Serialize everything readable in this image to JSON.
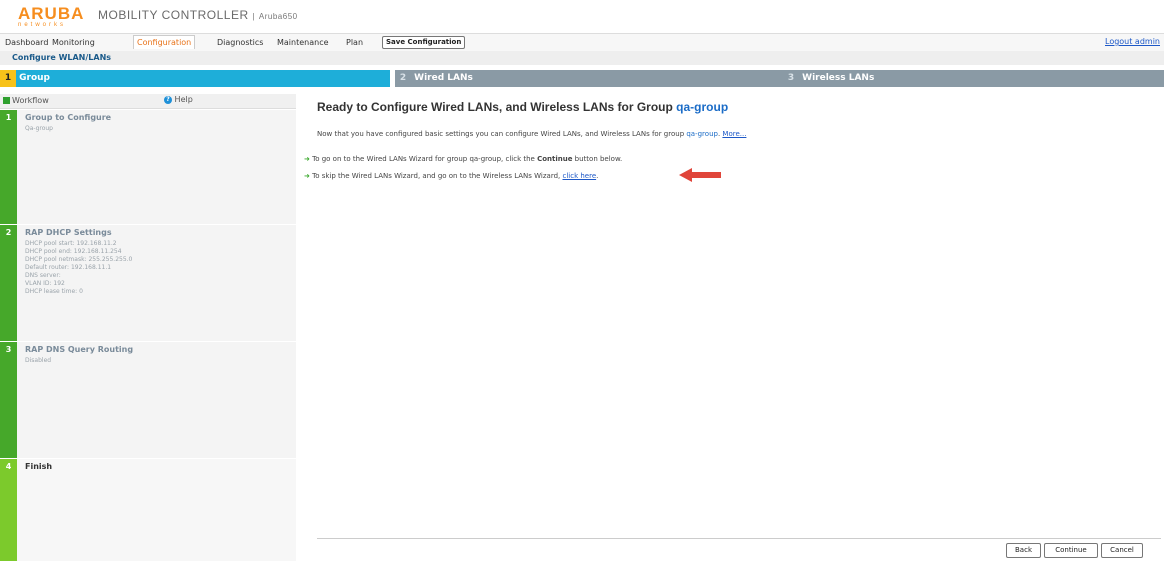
{
  "header": {
    "logo_text": "ARUBA",
    "logo_sub": "networks",
    "product": "MOBILITY CONTROLLER",
    "separator": "|",
    "model": "Aruba650"
  },
  "nav": {
    "tabs": [
      "Dashboard",
      "Monitoring",
      "Configuration",
      "Diagnostics",
      "Maintenance",
      "Plan"
    ],
    "active_tab": "Configuration",
    "save_label": "Save Configuration",
    "logout": "Logout admin"
  },
  "breadcrumb": "Configure WLAN/LANs",
  "steps": [
    {
      "num": "1",
      "label": "Group"
    },
    {
      "num": "2",
      "label": "Wired LANs"
    },
    {
      "num": "3",
      "label": "Wireless LANs"
    }
  ],
  "sidebar": {
    "workflow": "Workflow",
    "help": "Help",
    "help_icon": "?",
    "items": [
      {
        "num": "1",
        "title": "Group to Configure",
        "detail": "Qa-group"
      },
      {
        "num": "2",
        "title": "RAP DHCP Settings",
        "detail": "DHCP pool start: 192.168.11.2\nDHCP pool end: 192.168.11.254\nDHCP pool netmask: 255.255.255.0\nDefault router: 192.168.11.1\nDNS server:\nVLAN ID: 192\nDHCP lease time: 0"
      },
      {
        "num": "3",
        "title": "RAP DNS Query Routing",
        "detail": "Disabled"
      },
      {
        "num": "4",
        "title": "Finish",
        "detail": ""
      }
    ]
  },
  "main": {
    "title_prefix": "Ready to Configure Wired LANs, and Wireless LANs for Group ",
    "title_group": "qa-group",
    "intro_prefix": "Now that you have configured basic settings you can configure Wired LANs, and Wireless LANs for group ",
    "intro_group": "qa-group",
    "intro_more": "More...",
    "bullet1_prefix": "To go on to the Wired LANs Wizard for group qa-group, click the ",
    "bullet1_bold": "Continue",
    "bullet1_suffix": " button below.",
    "bullet2_prefix": "To skip the Wired LANs Wizard, and go on to the Wireless LANs Wizard, ",
    "bullet2_link": "click here",
    "bullet2_suffix": "."
  },
  "footer": {
    "back": "Back",
    "continue": "Continue",
    "cancel": "Cancel"
  },
  "colors": {
    "brand": "#f68d1e",
    "step_active": "#1eaed9",
    "step_inactive": "#8a9aa5",
    "workflow_green": "#46a82a",
    "finish_green": "#7cca2c"
  }
}
